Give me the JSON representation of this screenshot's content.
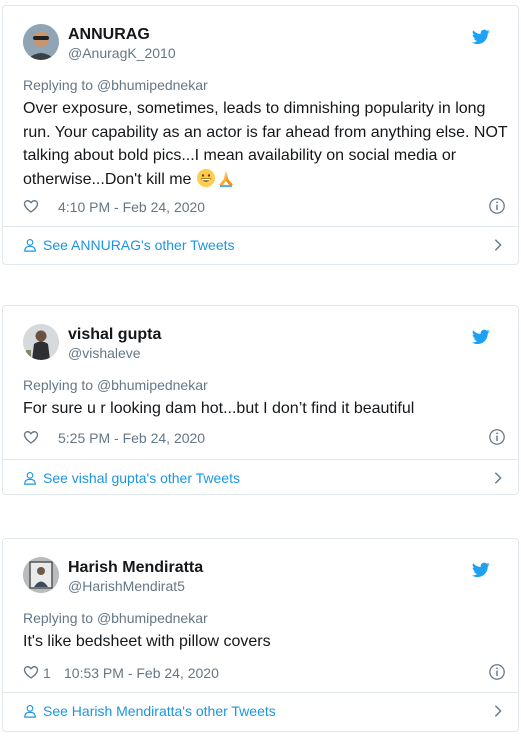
{
  "tweets": [
    {
      "name": "ANNURAG",
      "handle": "@AnuragK_2010",
      "reply_prefix": "Replying to ",
      "reply_to": "@bhumipednekar",
      "text": "Over exposure, sometimes, leads to dimnishing popularity in long run. Your capability as an actor is far ahead from anything else. NOT talking about bold pics...I mean availability on social media or otherwise...Don't kill me ",
      "emoji": [
        "grinning-face-emoji",
        "folded-hands-emoji"
      ],
      "likes": "",
      "time": "4:10 PM - Feb 24, 2020",
      "footer": "See ANNURAG's other Tweets"
    },
    {
      "name": "vishal gupta",
      "handle": "@vishaleve",
      "reply_prefix": "Replying to ",
      "reply_to": "@bhumipednekar",
      "text": "For sure u r looking dam hot...but I don’t find it beautiful",
      "likes": "",
      "time": "5:25 PM - Feb 24, 2020",
      "footer": "See vishal gupta's other Tweets"
    },
    {
      "name": "Harish Mendiratta",
      "handle": "@HarishMendirat5",
      "reply_prefix": "Replying to ",
      "reply_to": "@bhumipednekar",
      "text": "It's like bedsheet with pillow covers",
      "likes": "1",
      "time": "10:53 PM - Feb 24, 2020",
      "footer": "See Harish Mendiratta's other Tweets"
    }
  ],
  "colors": {
    "link": "#1b95e0",
    "muted": "#657786",
    "text": "#14171a",
    "border": "#e1e8ed",
    "twitter_blue": "#1da1f2"
  },
  "icons": [
    "twitter-bird-icon",
    "heart-icon",
    "info-icon",
    "person-icon",
    "chevron-right-icon"
  ]
}
